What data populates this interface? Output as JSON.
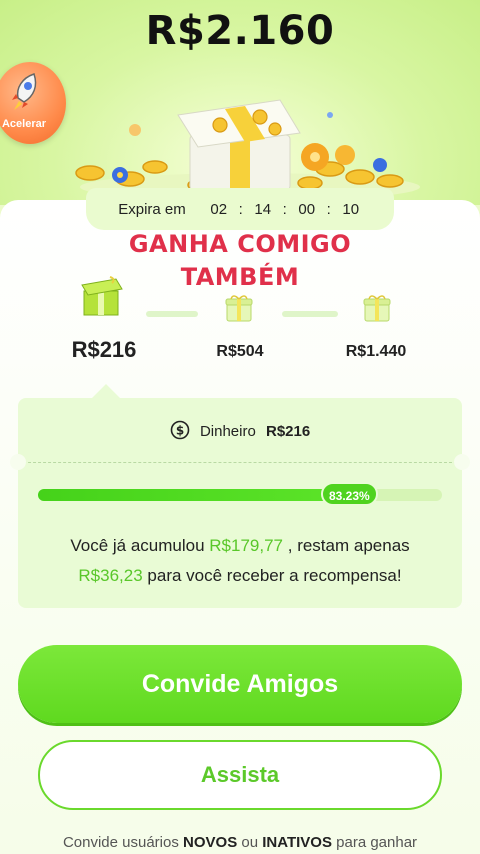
{
  "header": {
    "total_amount": "R$2.160"
  },
  "accelerate": {
    "label": "Acelerar",
    "icon": "rocket-icon"
  },
  "countdown": {
    "label": "Expira em",
    "hours": "02",
    "minutes": "14",
    "seconds": "00",
    "centis": "10",
    "separator": ":"
  },
  "headline": {
    "line1": "GANHA COMIGO",
    "line2": "TAMBÉM"
  },
  "tiers": [
    {
      "amount": "R$216",
      "icon": "open-gift-box-icon",
      "active": true
    },
    {
      "amount": "R$504",
      "icon": "gift-box-icon",
      "active": false
    },
    {
      "amount": "R$1.440",
      "icon": "gift-box-icon",
      "active": false
    }
  ],
  "cash": {
    "icon": "dollar-coin-icon",
    "label": "Dinheiro",
    "value": "R$216"
  },
  "progress": {
    "percent_label": "83.23%",
    "fraction": 0.8323
  },
  "accumulated": {
    "prefix": "Você já acumulou",
    "amount": "R$179,77",
    "middle": ", restam apenas",
    "remaining": "R$36,23",
    "suffix": "para você receber a recompensa!"
  },
  "buttons": {
    "invite": "Convide Amigos",
    "watch": "Assista"
  },
  "footer": {
    "part1": "Convide usuários",
    "novos": "NOVOS",
    "part2": "ou",
    "inativos": "INATIVOS",
    "part3": "para ganhar"
  },
  "colors": {
    "accent": "#5fd91f",
    "headline": "#e0304a",
    "highlight": "#59c72a"
  }
}
